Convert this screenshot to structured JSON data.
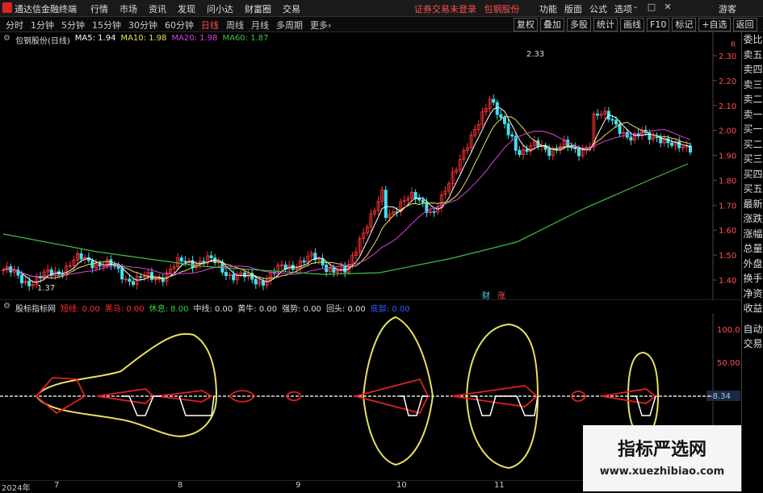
{
  "titlebar": {
    "app_name": "通达信金融终端",
    "menu": [
      "行情",
      "市场",
      "资讯",
      "发现",
      "问小达",
      "财富圈",
      "交易"
    ],
    "status": "证券交易未登录",
    "stock": "包钢股份",
    "right_menu": [
      "功能",
      "版面",
      "公式",
      "选项"
    ],
    "guest": "游客"
  },
  "periodbar": {
    "periods": [
      "分时",
      "1分钟",
      "5分钟",
      "15分钟",
      "30分钟",
      "60分钟",
      "日线",
      "周线",
      "月线",
      "多周期",
      "更多"
    ],
    "selected": "日线",
    "tools": [
      "复权",
      "叠加",
      "多股",
      "统计",
      "画线",
      "F10",
      "标记",
      "+自选",
      "返回"
    ]
  },
  "main_legend": {
    "stock": "包钢股份(日线)",
    "ma5": "MA5: 1.94",
    "ma10": "MA10: 1.98",
    "ma20": "MA20: 1.98",
    "ma60": "MA60: 1.87"
  },
  "indicator_legend": {
    "name": "股标指标网",
    "items": [
      {
        "label": "短线: 0.00",
        "color": "#ff3030"
      },
      {
        "label": "黑马: 0.00",
        "color": "#ff3030"
      },
      {
        "label": "休息: 8.00",
        "color": "#40d040"
      },
      {
        "label": "中线: 0.00",
        "color": "#dddddd"
      },
      {
        "label": "黄牛: 0.00",
        "color": "#dddddd"
      },
      {
        "label": "强势: 0.00",
        "color": "#dddddd"
      },
      {
        "label": "回头: 0.00",
        "color": "#dddddd"
      },
      {
        "label": "底部: 0.00",
        "color": "#3060ff"
      }
    ]
  },
  "price_axis": [
    "2.30",
    "2.20",
    "2.10",
    "2.00",
    "1.90",
    "1.80",
    "1.70",
    "1.60",
    "1.50",
    "1.40"
  ],
  "price_axis_unit": "R",
  "annotations": {
    "high": "2.33",
    "low": "1.37",
    "badge1": "财",
    "badge2": "涨"
  },
  "ind_axis": [
    "100.0",
    "50.00"
  ],
  "ind_current": "-8.34",
  "side_panel": [
    "委比",
    "卖五",
    "卖四",
    "卖三",
    "卖二",
    "卖一",
    "买一",
    "买二",
    "买三",
    "买四",
    "买五",
    "最新",
    "涨跌",
    "涨幅",
    "总量",
    "外盘",
    "换手",
    "净资",
    "收益",
    "自动",
    "交易"
  ],
  "time_axis": [
    "2024年",
    "7",
    "8",
    "9",
    "10",
    "11"
  ],
  "watermark": {
    "title": "指标严选网",
    "url": "www.xuezhibiao.com"
  },
  "colors": {
    "up": "#ff3333",
    "down": "#40e0f0",
    "ma5": "#ffffff",
    "ma10": "#e8e060",
    "ma20": "#e040e0",
    "ma60": "#40c040"
  }
}
